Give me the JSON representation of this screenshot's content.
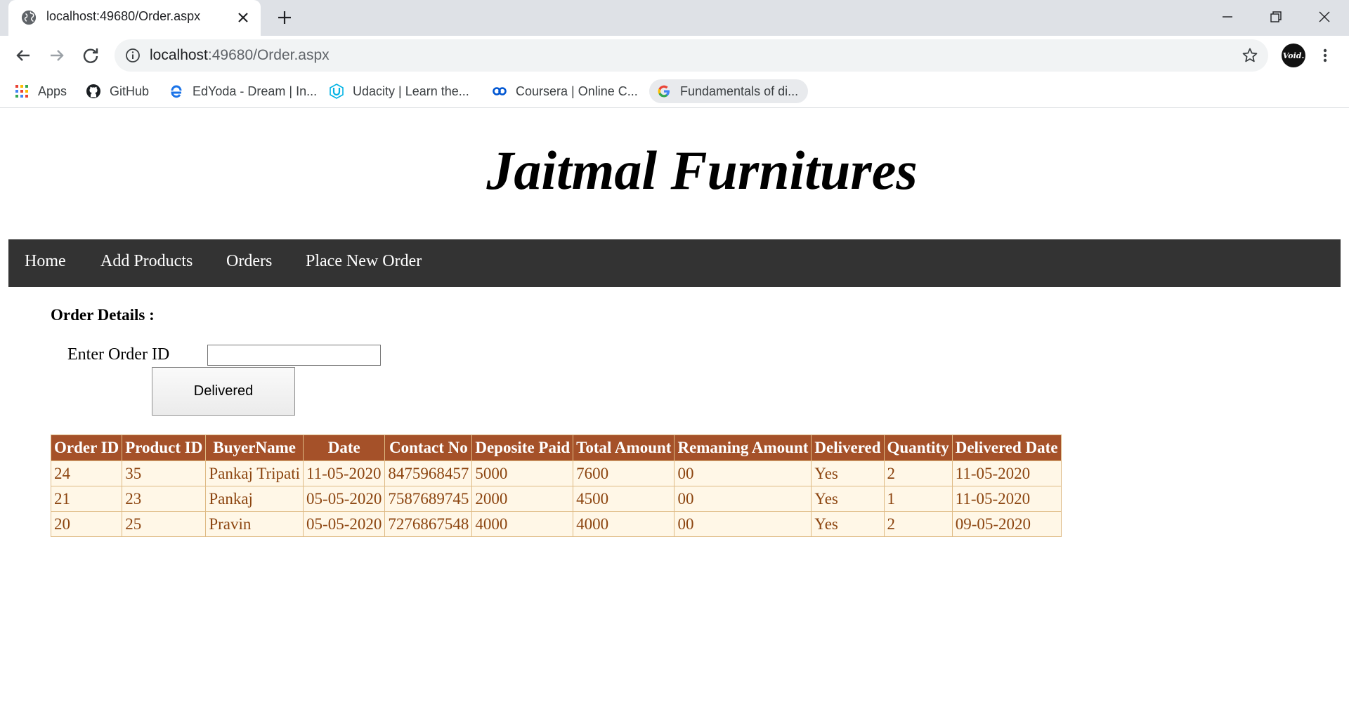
{
  "browser": {
    "tab_title": "localhost:49680/Order.aspx",
    "url_host": "localhost",
    "url_rest": ":49680/Order.aspx",
    "avatar_text": "Void.",
    "bookmarks": [
      {
        "label": "Apps",
        "icon": "apps-grid-icon"
      },
      {
        "label": "GitHub",
        "icon": "github-icon"
      },
      {
        "label": "EdYoda - Dream | In...",
        "icon": "edyoda-icon"
      },
      {
        "label": "Udacity | Learn the...",
        "icon": "udacity-icon"
      },
      {
        "label": "Coursera | Online C...",
        "icon": "coursera-icon"
      },
      {
        "label": "Fundamentals of di...",
        "icon": "google-icon"
      }
    ]
  },
  "page": {
    "site_title": "Jaitmal Furnitures",
    "nav": [
      "Home",
      "Add Products",
      "Orders",
      "Place New Order"
    ],
    "section_heading": "Order Details :",
    "order_id_label": "Enter Order ID",
    "order_id_value": "",
    "delivered_button": "Delivered"
  },
  "table": {
    "headers": [
      "Order ID",
      "Product ID",
      "BuyerName",
      "Date",
      "Contact No",
      "Deposite Paid",
      "Total Amount",
      "Remaning Amount",
      "Delivered",
      "Quantity",
      "Delivered Date"
    ],
    "rows": [
      [
        "24",
        "35",
        "Pankaj Tripati",
        "11-05-2020",
        "8475968457",
        "5000",
        "7600",
        "00",
        "Yes",
        "2",
        "11-05-2020"
      ],
      [
        "21",
        "23",
        "Pankaj",
        "05-05-2020",
        "7587689745",
        "2000",
        "4500",
        "00",
        "Yes",
        "1",
        "11-05-2020"
      ],
      [
        "20",
        "25",
        "Pravin",
        "05-05-2020",
        "7276867548",
        "4000",
        "4000",
        "00",
        "Yes",
        "2",
        "09-05-2020"
      ]
    ]
  },
  "colors": {
    "header_bg": "#a55129",
    "row_bg": "#fff7e7",
    "row_text": "#8c4510",
    "navbar_bg": "#333333"
  }
}
